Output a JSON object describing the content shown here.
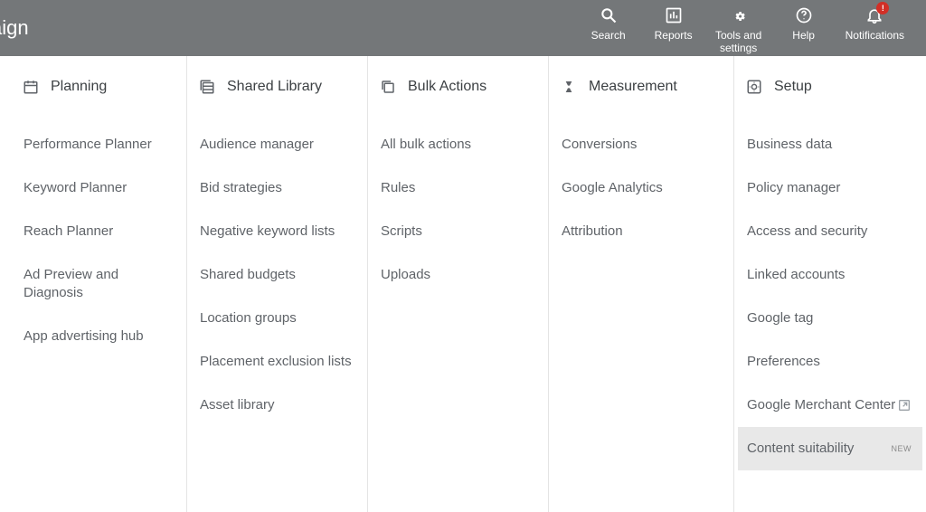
{
  "header": {
    "title_fragment": "aign",
    "nav": {
      "search": "Search",
      "reports": "Reports",
      "tools": "Tools and\nsettings",
      "help": "Help",
      "notifications": "Notifications",
      "notification_badge": "!"
    }
  },
  "menu": {
    "planning": {
      "title": "Planning",
      "items": [
        "Performance Planner",
        "Keyword Planner",
        "Reach Planner",
        "Ad Preview and Diagnosis",
        "App advertising hub"
      ]
    },
    "shared": {
      "title": "Shared Library",
      "items": [
        "Audience manager",
        "Bid strategies",
        "Negative keyword lists",
        "Shared budgets",
        "Location groups",
        "Placement exclusion lists",
        "Asset library"
      ]
    },
    "bulk": {
      "title": "Bulk Actions",
      "items": [
        "All bulk actions",
        "Rules",
        "Scripts",
        "Uploads"
      ]
    },
    "measurement": {
      "title": "Measurement",
      "items": [
        "Conversions",
        "Google Analytics",
        "Attribution"
      ]
    },
    "setup": {
      "title": "Setup",
      "items": [
        "Business data",
        "Policy manager",
        "Access and security",
        "Linked accounts",
        "Google tag",
        "Preferences",
        "Google Merchant Center",
        "Content suitability"
      ],
      "new_label": "NEW"
    }
  }
}
